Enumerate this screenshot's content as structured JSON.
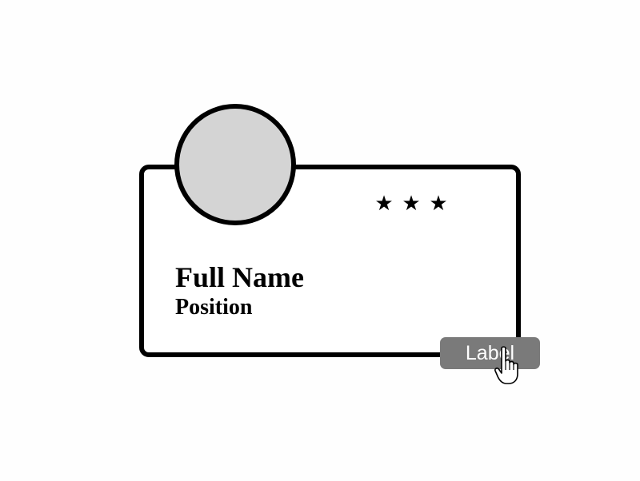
{
  "card": {
    "rating": 3,
    "stars": [
      "★",
      "★",
      "★"
    ],
    "full_name": "Full Name",
    "position": "Position",
    "action_label": "Label"
  },
  "colors": {
    "background": "#fefefe",
    "card_border": "#000000",
    "avatar_fill": "#d4d4d4",
    "button_fill": "#7a7a7a",
    "button_text": "#ffffff"
  },
  "icons": {
    "pointer": "hand-pointer-cursor-icon"
  }
}
